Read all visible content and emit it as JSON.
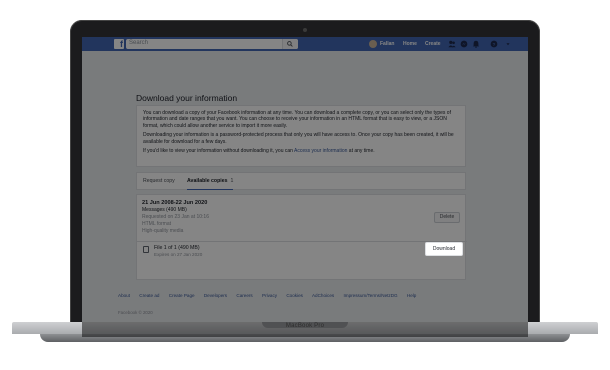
{
  "header": {
    "logo": "f",
    "search_placeholder": "Search",
    "user_name": "Fallan",
    "nav_home": "Home",
    "nav_create": "Create"
  },
  "main": {
    "title": "Download your information",
    "info": {
      "p1": "You can download a copy of your Facebook information at any time. You can download a complete copy, or you can select only the types of information and date ranges that you want. You can choose to receive your information in an HTML format that is easy to view, or a JSON format, which could allow another service to import it more easily.",
      "p2": "Downloading your information is a password-protected process that only you will have access to. Once your copy has been created, it will be available for download for a few days.",
      "p3_prefix": "If you'd like to view your information without downloading it, you can ",
      "p3_link": "Access your information",
      "p3_suffix": " at any time."
    },
    "tabs": {
      "request": "Request copy",
      "available": "Available copies",
      "available_count": "1"
    },
    "copy": {
      "date_range": "21 Jun 2008-22 Jun 2020",
      "category": "Messages (490 MB)",
      "requested": "Requested on 23 Jan at 10:16",
      "format": "HTML format",
      "quality": "High-quality media",
      "delete_label": "Delete",
      "file_label": "File 1 of 1 (490 MB)",
      "expires": "Expires on 27 Jan 2020",
      "download_label": "Download"
    }
  },
  "footer": {
    "links": [
      "About",
      "Create ad",
      "Create Page",
      "Developers",
      "Careers",
      "Privacy",
      "Cookies",
      "AdChoices",
      "Impressum/Terms/NetzDG",
      "Help"
    ],
    "copyright": "Facebook © 2020"
  },
  "device": {
    "brand": "MacBook Pro"
  },
  "colors": {
    "fb_blue": "#4267b2",
    "link": "#385898"
  },
  "icons": [
    "search-icon",
    "friends-icon",
    "messenger-icon",
    "notifications-icon",
    "help-icon",
    "chevron-down-icon",
    "file-icon",
    "adchoices-icon"
  ]
}
